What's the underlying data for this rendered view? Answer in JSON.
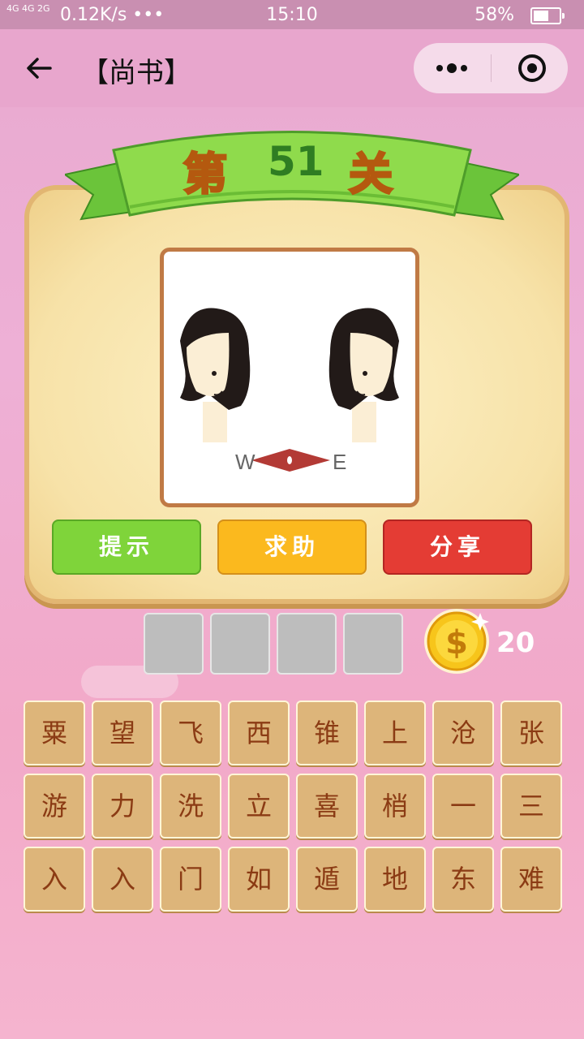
{
  "status": {
    "net": "4G 4G 2G",
    "speed": "0.12K/s •••",
    "time": "15:10",
    "battery": "58%",
    "battery_level": 0.58
  },
  "nav": {
    "title": "【尚书】"
  },
  "level": {
    "prefix": "第",
    "number": "51",
    "suffix": "关"
  },
  "puzzle_image": {
    "left_label": "W",
    "right_label": "E"
  },
  "buttons": {
    "hint": "提示",
    "help": "求助",
    "share": "分享"
  },
  "answer_slots": [
    "",
    "",
    "",
    ""
  ],
  "coins": "20",
  "chars": [
    [
      "粟",
      "望",
      "飞",
      "西",
      "锥",
      "上",
      "沧",
      "张"
    ],
    [
      "游",
      "力",
      "洗",
      "立",
      "喜",
      "梢",
      "一",
      "三"
    ],
    [
      "入",
      "入",
      "门",
      "如",
      "遁",
      "地",
      "东",
      "难"
    ]
  ],
  "colors": {
    "hint": "#7fd43a",
    "help": "#fbb91e",
    "share": "#e43c34",
    "tile": "#ddb57a",
    "tile_text": "#8b3b14"
  }
}
